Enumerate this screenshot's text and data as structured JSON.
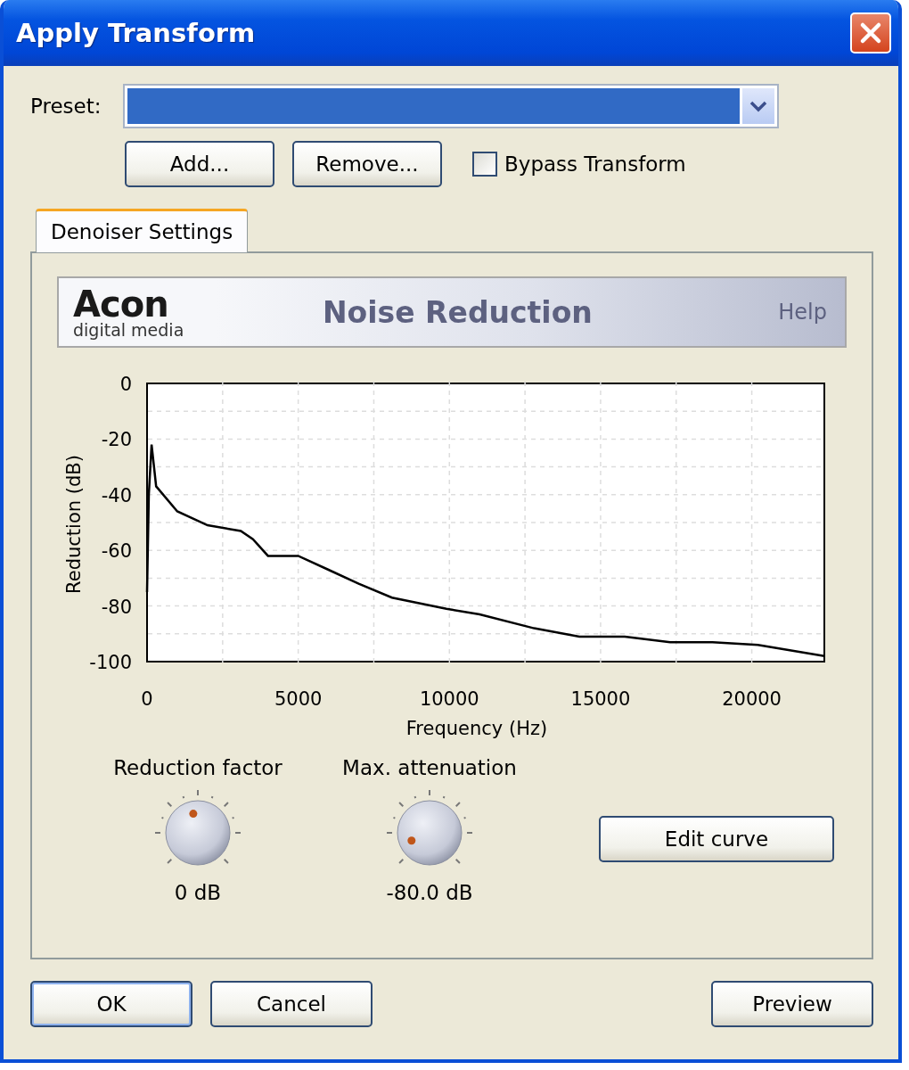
{
  "window": {
    "title": "Apply Transform"
  },
  "preset": {
    "label": "Preset:",
    "value_highlighted": true
  },
  "preset_buttons": [
    "Add...",
    "Remove..."
  ],
  "bypass": {
    "label": "Bypass Transform",
    "checked": false
  },
  "tabs": [
    {
      "label": "Denoiser Settings",
      "selected": true
    }
  ],
  "banner": {
    "logo": "Acon",
    "logo_subtitle": "digital media",
    "title": "Noise Reduction",
    "help": "Help"
  },
  "chart_data": {
    "type": "line",
    "grid": true,
    "xlabel": "Frequency (Hz)",
    "ylabel": "Reduction (dB)",
    "xlim": [
      0,
      22400
    ],
    "ylim": [
      -100,
      0
    ],
    "xticks": [
      0,
      5000,
      10000,
      15000,
      20000
    ],
    "yticks": [
      0,
      -20,
      -40,
      -60,
      -80,
      -100
    ],
    "x": [
      0,
      60,
      150,
      300,
      1000,
      2000,
      3100,
      3500,
      4000,
      5000,
      6000,
      7000,
      8100,
      9900,
      11000,
      12800,
      14300,
      15800,
      17300,
      18700,
      20200,
      22400
    ],
    "series": [
      {
        "color": "#000000",
        "values": [
          -75,
          -40,
          -22,
          -37,
          -46,
          -51,
          -53,
          -56,
          -62,
          -62,
          -67,
          -72,
          -77,
          -81,
          -83,
          -88,
          -91,
          -91,
          -93,
          -93,
          -94,
          -98
        ]
      }
    ]
  },
  "knobs": [
    {
      "label": "Reduction factor",
      "reading": "0 dB"
    },
    {
      "label": "Max. attenuation",
      "reading": "-80.0 dB"
    }
  ],
  "edit_curve_button": "Edit curve",
  "footer_buttons": [
    {
      "label": "OK",
      "default": true
    },
    {
      "label": "Cancel",
      "default": false
    },
    {
      "label": "Preview",
      "default": false
    }
  ]
}
